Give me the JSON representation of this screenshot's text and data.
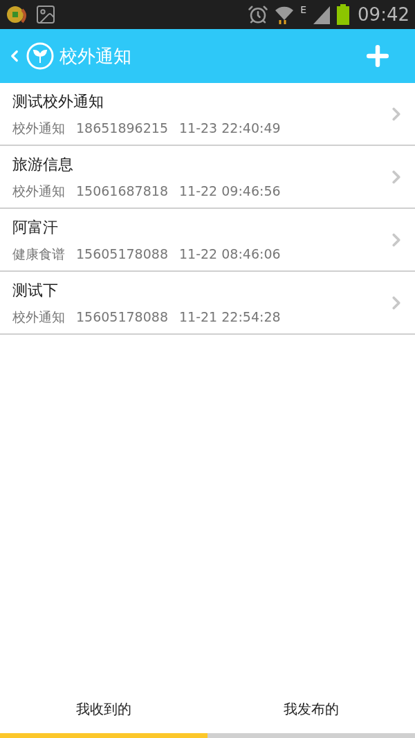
{
  "status_bar": {
    "network": "E",
    "time": "09:42"
  },
  "header": {
    "title": "校外通知"
  },
  "notices": [
    {
      "title": "测试校外通知",
      "category": "校外通知",
      "phone": "18651896215",
      "time": "11-23 22:40:49"
    },
    {
      "title": "旅游信息",
      "category": "校外通知",
      "phone": "15061687818",
      "time": "11-22 09:46:56"
    },
    {
      "title": "阿富汗",
      "category": "健康食谱",
      "phone": "15605178088",
      "time": "11-22 08:46:06"
    },
    {
      "title": "测试下",
      "category": "校外通知",
      "phone": "15605178088",
      "time": "11-21 22:54:28"
    }
  ],
  "tabs": [
    {
      "label": "我收到的",
      "selected": true
    },
    {
      "label": "我发布的",
      "selected": false
    }
  ]
}
